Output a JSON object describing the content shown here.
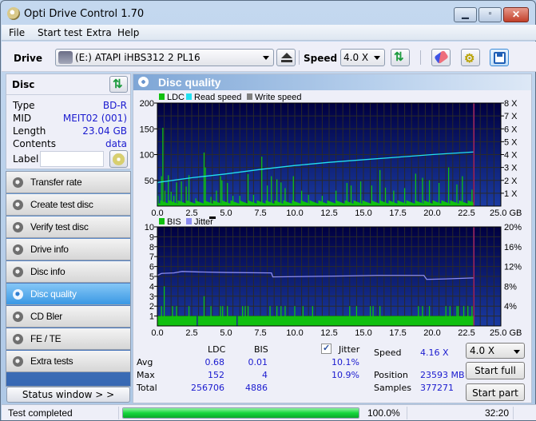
{
  "window": {
    "title": "Opti Drive Control 1.70",
    "controls": {
      "minimize": "▁",
      "maximize": "▫",
      "close": "✕"
    }
  },
  "menu": [
    "File",
    "Start test",
    "Extra",
    "Help"
  ],
  "toolbar": {
    "drive_label": "Drive",
    "drive_value": "(E:)   ATAPI iHBS312   2 PL16",
    "speed_label": "Speed",
    "speed_value": "4.0 X",
    "icons": [
      "drive-icon",
      "eject-icon",
      "refresh-icon",
      "erase-icon",
      "settings-icon",
      "save-icon"
    ]
  },
  "disc": {
    "header": "Disc",
    "rows": [
      {
        "key": "Type",
        "value": "BD-R"
      },
      {
        "key": "MID",
        "value": "MEIT02 (001)"
      },
      {
        "key": "Length",
        "value": "23.04 GB"
      },
      {
        "key": "Contents",
        "value": "data"
      }
    ],
    "label_key": "Label",
    "label_value": ""
  },
  "nav": {
    "items": [
      {
        "label": "Transfer rate",
        "active": false
      },
      {
        "label": "Create test disc",
        "active": false
      },
      {
        "label": "Verify test disc",
        "active": false
      },
      {
        "label": "Drive info",
        "active": false
      },
      {
        "label": "Disc info",
        "active": false
      },
      {
        "label": "Disc quality",
        "active": true
      },
      {
        "label": "CD Bler",
        "active": false
      },
      {
        "label": "FE / TE",
        "active": false
      },
      {
        "label": "Extra tests",
        "active": false
      }
    ],
    "status_window": "Status window > >"
  },
  "main": {
    "title": "Disc quality"
  },
  "colors": {
    "ldc": "#10c010",
    "read_speed": "#22e0f0",
    "write_speed": "#808080",
    "bis": "#10c010",
    "jitter": "#8c8cf0",
    "plot_bg_top": "#000040",
    "plot_bg_bottom": "#1a3aa0",
    "end_marker": "#a0206a"
  },
  "chart_data": [
    {
      "type": "bar",
      "title": "LDC / Read speed",
      "legend": [
        "LDC",
        "Read speed",
        "Write speed"
      ],
      "legend_position": "top-left",
      "xlabel": "GB",
      "x_range": [
        0,
        25
      ],
      "x_ticks": [
        "0.0",
        "2.5",
        "5.0",
        "7.5",
        "10.0",
        "12.5",
        "15.0",
        "17.5",
        "20.0",
        "22.5",
        "25.0 GB"
      ],
      "y_left_range": [
        0,
        200
      ],
      "y_left_ticks": [
        "50",
        "100",
        "150",
        "200"
      ],
      "y_right_range": [
        0,
        8
      ],
      "y_right_ticks": [
        "1 X",
        "2 X",
        "3 X",
        "4 X",
        "5 X",
        "6 X",
        "7 X",
        "8 X"
      ],
      "grid": true,
      "end_position_gb": 23.04,
      "ldc_spikes": [
        {
          "x": 0.05,
          "y": 20
        },
        {
          "x": 0.3,
          "y": 58
        },
        {
          "x": 0.4,
          "y": 152
        },
        {
          "x": 0.55,
          "y": 30
        },
        {
          "x": 0.8,
          "y": 60
        },
        {
          "x": 1.0,
          "y": 28
        },
        {
          "x": 1.2,
          "y": 20
        },
        {
          "x": 1.4,
          "y": 46
        },
        {
          "x": 1.75,
          "y": 48
        },
        {
          "x": 2.1,
          "y": 38
        },
        {
          "x": 2.3,
          "y": 60
        },
        {
          "x": 2.8,
          "y": 15
        },
        {
          "x": 3.4,
          "y": 104
        },
        {
          "x": 3.5,
          "y": 75
        },
        {
          "x": 3.9,
          "y": 18
        },
        {
          "x": 4.3,
          "y": 30
        },
        {
          "x": 4.6,
          "y": 58
        },
        {
          "x": 4.7,
          "y": 50
        },
        {
          "x": 5.1,
          "y": 45
        },
        {
          "x": 5.5,
          "y": 20
        },
        {
          "x": 6.0,
          "y": 20
        },
        {
          "x": 6.6,
          "y": 62
        },
        {
          "x": 7.0,
          "y": 22
        },
        {
          "x": 7.6,
          "y": 96
        },
        {
          "x": 8.0,
          "y": 40
        },
        {
          "x": 8.3,
          "y": 58
        },
        {
          "x": 8.7,
          "y": 52
        },
        {
          "x": 9.0,
          "y": 46
        },
        {
          "x": 9.3,
          "y": 35
        },
        {
          "x": 9.9,
          "y": 58
        },
        {
          "x": 10.5,
          "y": 30
        },
        {
          "x": 11.0,
          "y": 22
        },
        {
          "x": 12.0,
          "y": 20
        },
        {
          "x": 13.0,
          "y": 30
        },
        {
          "x": 13.8,
          "y": 45
        },
        {
          "x": 14.1,
          "y": 40
        },
        {
          "x": 14.8,
          "y": 48
        },
        {
          "x": 15.6,
          "y": 40
        },
        {
          "x": 16.2,
          "y": 70
        },
        {
          "x": 16.6,
          "y": 36
        },
        {
          "x": 17.2,
          "y": 30
        },
        {
          "x": 18.0,
          "y": 35
        },
        {
          "x": 18.8,
          "y": 63
        },
        {
          "x": 19.3,
          "y": 55
        },
        {
          "x": 19.8,
          "y": 50
        },
        {
          "x": 20.5,
          "y": 45
        },
        {
          "x": 21.2,
          "y": 75
        },
        {
          "x": 21.8,
          "y": 42
        },
        {
          "x": 22.2,
          "y": 58
        },
        {
          "x": 22.9,
          "y": 32
        }
      ],
      "ldc_baseline": 5,
      "read_speed": [
        {
          "x": 0.0,
          "y": 1.8
        },
        {
          "x": 0.1,
          "y": 1.85
        },
        {
          "x": 2.5,
          "y": 2.2
        },
        {
          "x": 5.0,
          "y": 2.5
        },
        {
          "x": 7.5,
          "y": 2.85
        },
        {
          "x": 10.0,
          "y": 3.15
        },
        {
          "x": 12.5,
          "y": 3.4
        },
        {
          "x": 15.0,
          "y": 3.6
        },
        {
          "x": 17.5,
          "y": 3.8
        },
        {
          "x": 20.0,
          "y": 4.0
        },
        {
          "x": 23.0,
          "y": 4.2
        }
      ]
    },
    {
      "type": "bar",
      "title": "BIS / Jitter",
      "legend": [
        "BIS",
        "Jitter"
      ],
      "legend_position": "top-left",
      "xlabel": "GB",
      "x_range": [
        0,
        25
      ],
      "x_ticks": [
        "0.0",
        "2.5",
        "5.0",
        "7.5",
        "10.0",
        "12.5",
        "15.0",
        "17.5",
        "20.0",
        "22.5",
        "25.0 GB"
      ],
      "y_left_range": [
        0,
        10
      ],
      "y_left_ticks": [
        "1",
        "2",
        "3",
        "4",
        "5",
        "6",
        "7",
        "8",
        "9",
        "10"
      ],
      "y_right_range": [
        0,
        20
      ],
      "y_right_ticks": [
        "4%",
        "8%",
        "12%",
        "16%",
        "20%"
      ],
      "grid": true,
      "end_position_gb": 23.04,
      "bis_baseline": 1,
      "bis_spikes": [
        {
          "x": 0.3,
          "y": 2
        },
        {
          "x": 0.5,
          "y": 4
        },
        {
          "x": 1.1,
          "y": 2
        },
        {
          "x": 1.4,
          "y": 2
        },
        {
          "x": 2.3,
          "y": 2
        },
        {
          "x": 3.4,
          "y": 3
        },
        {
          "x": 3.9,
          "y": 2
        },
        {
          "x": 4.6,
          "y": 2
        },
        {
          "x": 4.75,
          "y": 2
        },
        {
          "x": 5.1,
          "y": 2
        },
        {
          "x": 6.2,
          "y": 2
        },
        {
          "x": 6.4,
          "y": 2
        },
        {
          "x": 6.6,
          "y": 2
        },
        {
          "x": 8.2,
          "y": 2
        },
        {
          "x": 8.7,
          "y": 2
        },
        {
          "x": 9.0,
          "y": 2
        },
        {
          "x": 9.3,
          "y": 2
        },
        {
          "x": 10.0,
          "y": 2
        },
        {
          "x": 10.6,
          "y": 2
        },
        {
          "x": 11.3,
          "y": 2
        },
        {
          "x": 14.0,
          "y": 2
        },
        {
          "x": 14.5,
          "y": 2
        },
        {
          "x": 15.5,
          "y": 2
        },
        {
          "x": 15.7,
          "y": 2
        },
        {
          "x": 16.2,
          "y": 2
        },
        {
          "x": 19.0,
          "y": 2
        },
        {
          "x": 19.3,
          "y": 2
        },
        {
          "x": 19.8,
          "y": 2
        },
        {
          "x": 21.0,
          "y": 2
        },
        {
          "x": 21.3,
          "y": 2
        },
        {
          "x": 21.8,
          "y": 2
        },
        {
          "x": 21.9,
          "y": 2
        },
        {
          "x": 22.3,
          "y": 2
        },
        {
          "x": 22.6,
          "y": 2
        },
        {
          "x": 22.9,
          "y": 2
        }
      ],
      "bis_gaps": [
        2.9,
        5.8
      ],
      "jitter": [
        {
          "x": 0.0,
          "y": 10.2
        },
        {
          "x": 0.3,
          "y": 10.6
        },
        {
          "x": 1.2,
          "y": 10.7
        },
        {
          "x": 1.8,
          "y": 11.0
        },
        {
          "x": 3.0,
          "y": 10.9
        },
        {
          "x": 5.0,
          "y": 10.8
        },
        {
          "x": 8.3,
          "y": 10.7
        },
        {
          "x": 8.4,
          "y": 9.9
        },
        {
          "x": 11.2,
          "y": 10.0
        },
        {
          "x": 14.0,
          "y": 10.1
        },
        {
          "x": 16.0,
          "y": 10.2
        },
        {
          "x": 19.4,
          "y": 10.2
        },
        {
          "x": 19.6,
          "y": 9.4
        },
        {
          "x": 21.0,
          "y": 9.5
        },
        {
          "x": 23.0,
          "y": 9.7
        }
      ]
    }
  ],
  "stats": {
    "col_ldc": "LDC",
    "col_bis": "BIS",
    "col_jitter": "Jitter",
    "jitter_checked": true,
    "rows": [
      {
        "label": "Avg",
        "ldc": "0.68",
        "bis": "0.01",
        "jitter": "10.1%"
      },
      {
        "label": "Max",
        "ldc": "152",
        "bis": "4",
        "jitter": "10.9%"
      },
      {
        "label": "Total",
        "ldc": "256706",
        "bis": "4886",
        "jitter": ""
      }
    ],
    "speed_label": "Speed",
    "speed_value": "4.16 X",
    "position_label": "Position",
    "position_value": "23593 MB",
    "samples_label": "Samples",
    "samples_value": "377271",
    "speed_select": "4.0 X",
    "start_full": "Start full",
    "start_part": "Start part"
  },
  "statusbar": {
    "text": "Test completed",
    "progress": 1.0,
    "progress_text": "100.0%",
    "time": "32:20"
  }
}
